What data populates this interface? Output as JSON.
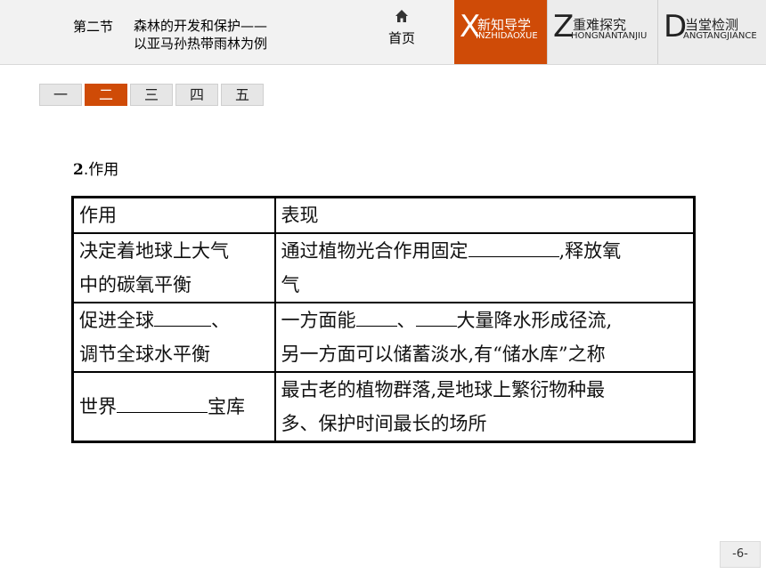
{
  "header": {
    "section_number": "第二节",
    "section_title_line1": "森林的开发和保护——",
    "section_title_line2": "以亚马孙热带雨林为例",
    "home_label": "首页",
    "tabs": [
      {
        "letter": "X",
        "title": "新知导学",
        "pinyin": "INZHIDAOXUE"
      },
      {
        "letter": "Z",
        "title": "重难探究",
        "pinyin": "HONGNANTANJIU"
      },
      {
        "letter": "D",
        "title": "当堂检测",
        "pinyin": "ANGTANGJIANCE"
      }
    ]
  },
  "pager": [
    "一",
    "二",
    "三",
    "四",
    "五"
  ],
  "content": {
    "subhead_num": "2",
    "subhead_text": ".作用",
    "table": {
      "headers": [
        "作用",
        "表现"
      ],
      "rows": [
        {
          "c1_a": "决定着地球上大气",
          "c1_b": "中的碳氧平衡",
          "c2_a_pre": "通过植物光合作用固定",
          "c2_a_post": ",释放氧",
          "c2_b": "气"
        },
        {
          "c1_a_pre": "促进全球",
          "c1_a_post": "、",
          "c1_b": "调节全球水平衡",
          "c2_a_pre": "一方面能",
          "c2_a_mid": "、",
          "c2_a_post": "大量降水形成径流,",
          "c2_b": "另一方面可以储蓄淡水,有“储水库”之称"
        },
        {
          "c1_pre": "世界",
          "c1_post": "宝库",
          "c2_a": "最古老的植物群落,是地球上繁衍物种最",
          "c2_b": "多、保护时间最长的场所"
        }
      ]
    }
  },
  "page_number": "-6-",
  "colors": {
    "accent": "#cf4b07",
    "header_bg": "#f2f2f2"
  }
}
